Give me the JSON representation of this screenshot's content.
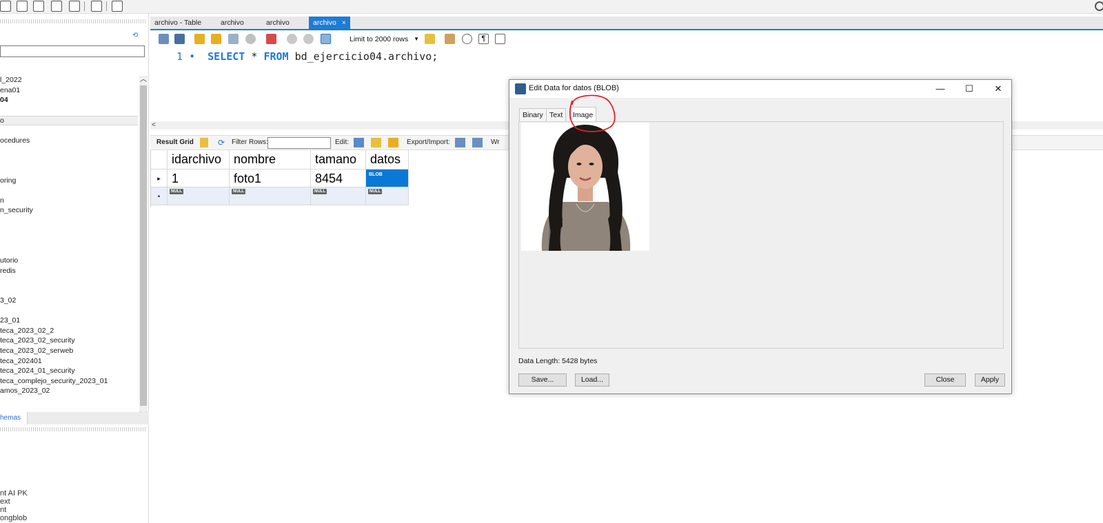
{
  "navigator": {
    "tree_items": [
      "l_2022",
      "ena01",
      "04",
      "o",
      "ocedures",
      "oring",
      "n",
      "n_security",
      "utorio",
      "redis",
      "3_02",
      "23_01",
      "teca_2023_02_2",
      "teca_2023_02_security",
      "teca_2023_02_serweb",
      "teca_202401",
      "teca_2024_01_security",
      "teca_complejo_security_2023_01",
      "amos_2023_02"
    ],
    "schemas_tab": "hemas",
    "info_lines": [
      "nt AI PK",
      "ext",
      "nt",
      "ongblob"
    ]
  },
  "editor_tabs": [
    {
      "label": "archivo - Table"
    },
    {
      "label": "archivo"
    },
    {
      "label": "archivo"
    },
    {
      "label": "archivo",
      "close": "×"
    }
  ],
  "sql_toolbar": {
    "limit_label": "Limit to 2000 rows"
  },
  "code": {
    "line_number": "1",
    "marker": "•",
    "kw_select": "SELECT",
    "star": "*",
    "kw_from": "FROM",
    "target": "bd_ejercicio04.archivo;"
  },
  "result_toolbar": {
    "result_grid": "Result Grid",
    "filter_rows": "Filter Rows:",
    "edit": "Edit:",
    "export_import": "Export/Import:",
    "wrap_partial": "Wr"
  },
  "grid": {
    "columns": [
      "idarchivo",
      "nombre",
      "tamano",
      "datos"
    ],
    "row": [
      "1",
      "foto1",
      "8454",
      "BLOB"
    ],
    "null_label": "NULL"
  },
  "dialog": {
    "title": "Edit Data for datos (BLOB)",
    "tabs": [
      "Binary",
      "Text",
      "Image"
    ],
    "active_tab": "Image",
    "data_length": "Data Length: 5428 bytes",
    "buttons": {
      "save": "Save...",
      "load": "Load...",
      "close": "Close",
      "apply": "Apply"
    },
    "window_controls": {
      "minimize": "—",
      "maximize": "☐",
      "close": "✕"
    }
  },
  "colors": {
    "accent": "#1e7bd6",
    "selection": "#0a78d7",
    "annotation": "#e0202a"
  }
}
